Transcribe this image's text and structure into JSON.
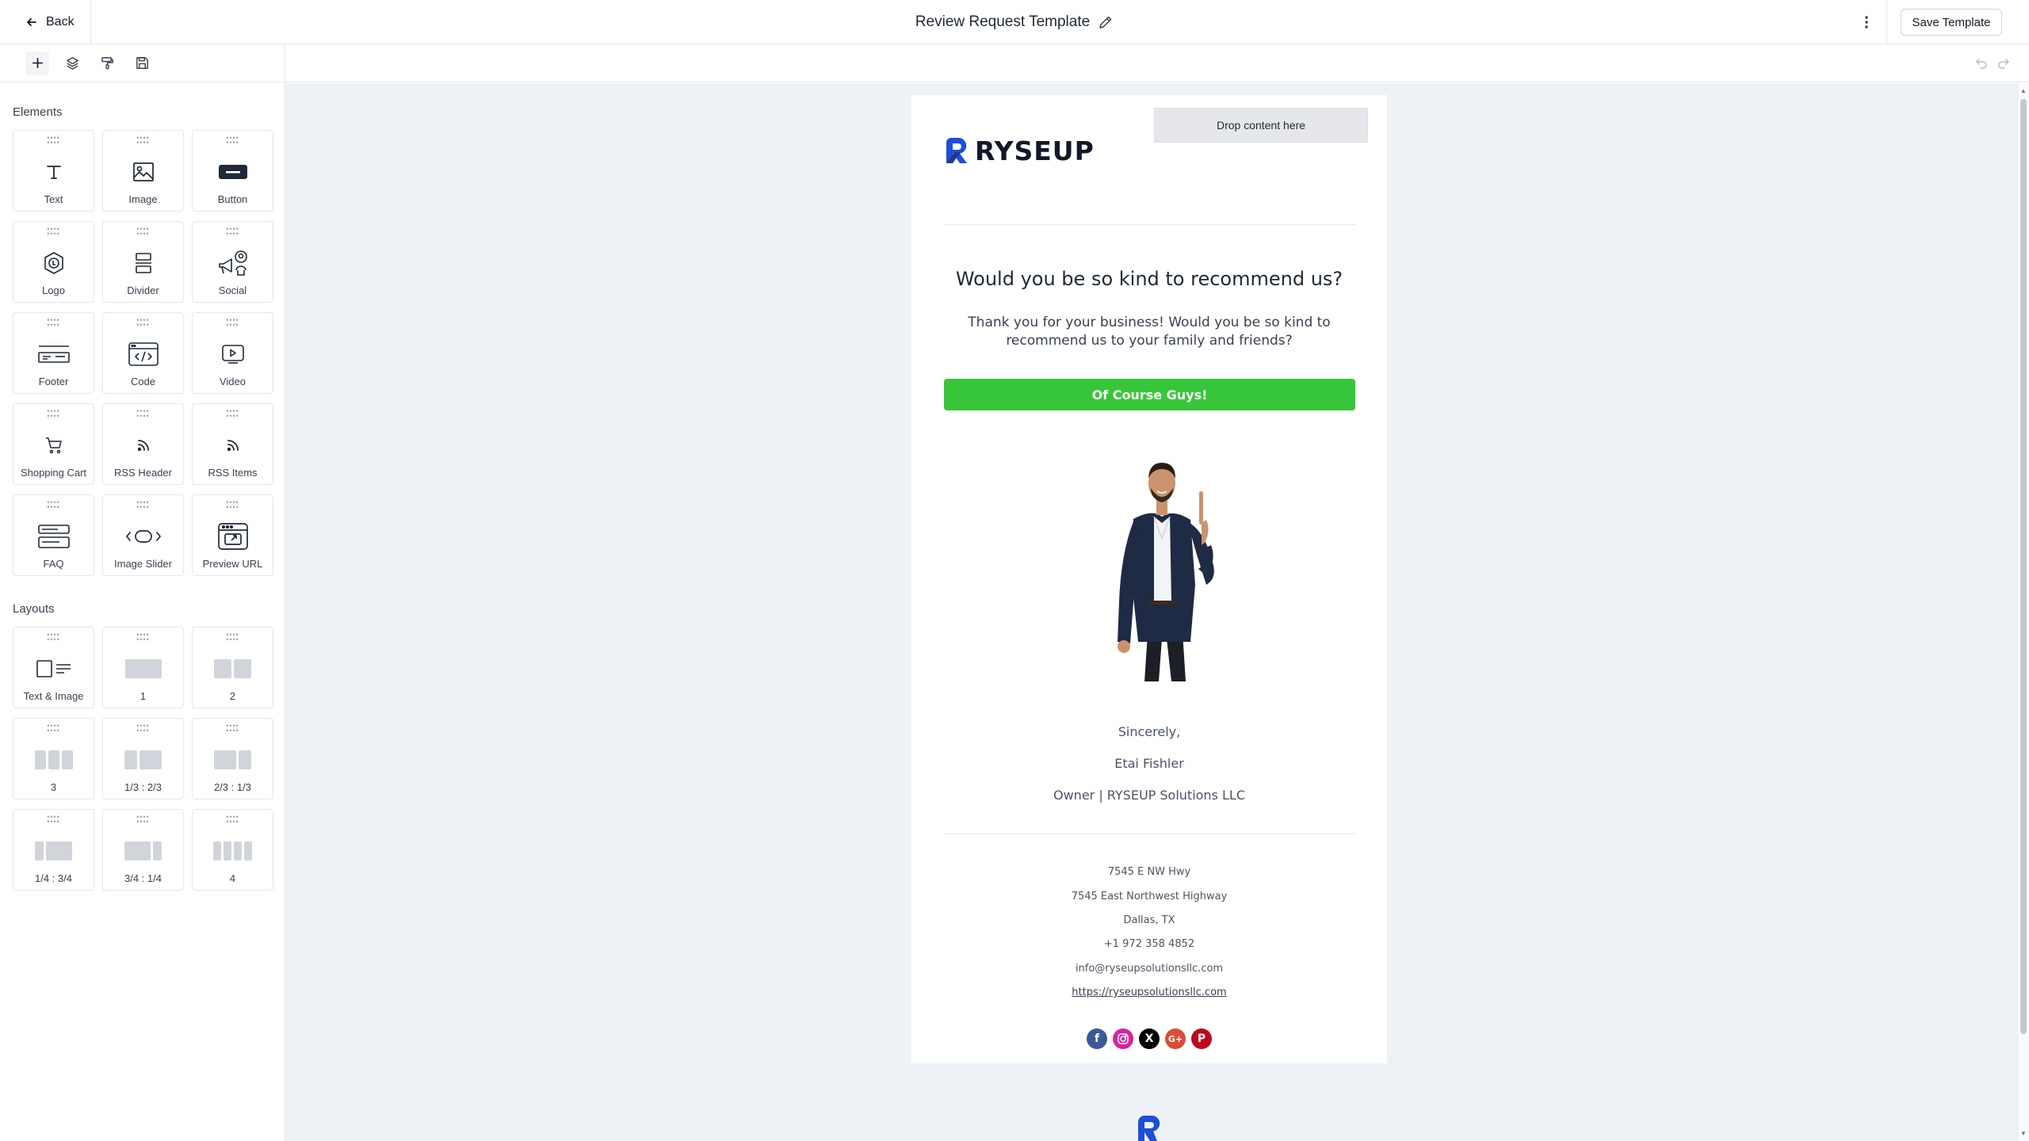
{
  "header": {
    "back_label": "Back",
    "title": "Review Request Template",
    "save_label": "Save Template"
  },
  "toolbar": {
    "tools": [
      "add-icon",
      "layers-icon",
      "paint-roller-icon",
      "save-disk-icon"
    ],
    "undo_icon": "undo-icon",
    "redo_icon": "redo-icon"
  },
  "sidebar": {
    "elements_title": "Elements",
    "elements": [
      {
        "label": "Text",
        "icon": "text-icon"
      },
      {
        "label": "Image",
        "icon": "image-icon"
      },
      {
        "label": "Button",
        "icon": "button-icon"
      },
      {
        "label": "Logo",
        "icon": "logo-icon"
      },
      {
        "label": "Divider",
        "icon": "divider-icon"
      },
      {
        "label": "Social",
        "icon": "social-icon"
      },
      {
        "label": "Footer",
        "icon": "footer-icon"
      },
      {
        "label": "Code",
        "icon": "code-icon"
      },
      {
        "label": "Video",
        "icon": "video-icon"
      },
      {
        "label": "Shopping Cart",
        "icon": "cart-icon"
      },
      {
        "label": "RSS Header",
        "icon": "rss-icon"
      },
      {
        "label": "RSS Items",
        "icon": "rss-icon"
      },
      {
        "label": "FAQ",
        "icon": "faq-icon"
      },
      {
        "label": "Image Slider",
        "icon": "slider-icon"
      },
      {
        "label": "Preview URL",
        "icon": "preview-url-icon"
      }
    ],
    "layouts_title": "Layouts",
    "layouts": [
      {
        "label": "Text & Image"
      },
      {
        "label": "1"
      },
      {
        "label": "2"
      },
      {
        "label": "3"
      },
      {
        "label": "1/3 : 2/3"
      },
      {
        "label": "2/3 : 1/3"
      },
      {
        "label": "1/4 : 3/4"
      },
      {
        "label": "3/4 : 1/4"
      },
      {
        "label": "4"
      }
    ]
  },
  "email": {
    "drop_zone": "Drop content here",
    "brand": "RYSEUP",
    "headline": "Would you be so kind to recommend us?",
    "body": "Thank you for your business! Would you be so kind to recommend us to your family and friends?",
    "cta": "Of Course Guys!",
    "closing": "Sincerely,",
    "signer": "Etai Fishler",
    "signer_title": "Owner | RYSEUP Solutions LLC",
    "footer": {
      "address1": "7545 E NW Hwy",
      "address2": "7545 East Northwest Highway",
      "city": "Dallas, TX",
      "phone": "+1 972 358 4852",
      "email": "info@ryseupsolutionsllc.com",
      "url": "https://ryseupsolutionsllc.com"
    },
    "socials": [
      {
        "name": "facebook-icon",
        "glyph": "f",
        "color": "#3b5998"
      },
      {
        "name": "instagram-icon",
        "glyph": "◎",
        "color": "#d6249f"
      },
      {
        "name": "x-icon",
        "glyph": "X",
        "color": "#000000"
      },
      {
        "name": "google-plus-icon",
        "glyph": "G+",
        "color": "#dd4b39"
      },
      {
        "name": "pinterest-icon",
        "glyph": "P",
        "color": "#bd081c"
      }
    ]
  },
  "colors": {
    "cta_green": "#37c63a",
    "canvas_bg": "#eef2f7",
    "brand_blue": "#1d4ed8"
  }
}
